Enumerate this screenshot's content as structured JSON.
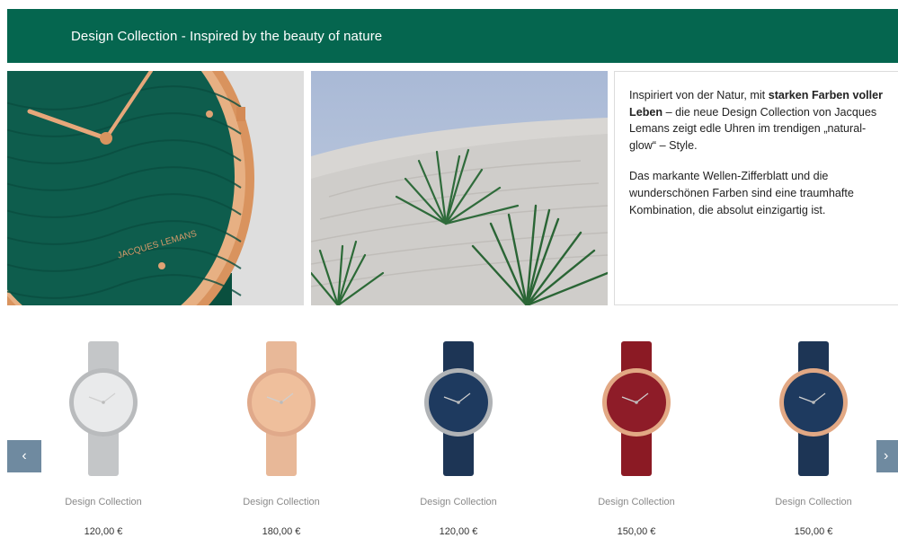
{
  "banner": {
    "title": "Design Collection - Inspired by the beauty of nature"
  },
  "hero": {
    "watch_brand": "JACQUES LEMANS",
    "text": {
      "p1_pre": "Inspiriert von der Natur, mit ",
      "p1_bold": "starken Farben voller Leben",
      "p1_post": " – die neue Design Collection von Jacques Lemans zeigt edle Uhren im trendigen „natural-glow“ – Style.",
      "p2": "Das markante Wellen-Zifferblatt und die wunderschönen Farben sind eine traumhafte Kombination, die absolut einzigartig ist."
    }
  },
  "carousel": {
    "prev_icon": "chevron-left-icon",
    "next_icon": "chevron-right-icon",
    "prev_glyph": "‹",
    "next_glyph": "›",
    "products": [
      {
        "name": "Design Collection",
        "price": "120,00 €",
        "strap": "#c4c6c8",
        "case": "#b9bbbd",
        "dial": "#e9eaeb"
      },
      {
        "name": "Design Collection",
        "price": "180,00 €",
        "strap": "#e8b898",
        "case": "#e0a98a",
        "dial": "#efbf9c"
      },
      {
        "name": "Design Collection",
        "price": "120,00 €",
        "strap": "#1d3555",
        "case": "#b0b3b6",
        "dial": "#1e3a5f"
      },
      {
        "name": "Design Collection",
        "price": "150,00 €",
        "strap": "#8b1a24",
        "case": "#e2a884",
        "dial": "#8e1c28"
      },
      {
        "name": "Design Collection",
        "price": "150,00 €",
        "strap": "#1d3555",
        "case": "#e2a884",
        "dial": "#1e3a5f"
      }
    ]
  }
}
